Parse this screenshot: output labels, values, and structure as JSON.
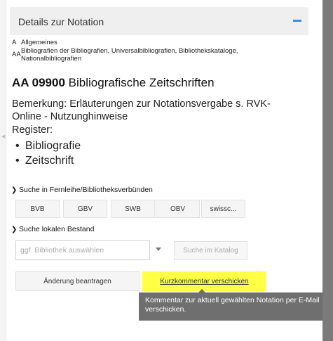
{
  "panel": {
    "title": "Details zur Notation"
  },
  "hierarchy": [
    {
      "code": "A",
      "label": "Allgemeines"
    },
    {
      "code": "AA",
      "label": "Bibliografien der Bibliografien, Universalbibliografien, Bibliothekskataloge, Nationalbibliografien"
    }
  ],
  "notation": {
    "code": "AA 09900",
    "title": "Bibliografische Zeitschriften"
  },
  "remark": "Bemerkung: Erläuterungen zur Notationsvergabe s. RVK-Online - Nutzunghinweise",
  "register": {
    "label": "Register:",
    "items": [
      "Bibliografie",
      "Zeitschrift"
    ]
  },
  "fernleihe": {
    "heading": "Suche in Fernleihe/Bibliotheksverbünden",
    "buttons": [
      "BVB",
      "GBV",
      "SWB",
      "OBV",
      "swissc..."
    ]
  },
  "local": {
    "heading": "Suche lokalen Bestand",
    "select_placeholder": "ggf. Bibliothek auswählen",
    "search_button": "Suche im Katalog"
  },
  "actions": {
    "change_button": "Änderung beantragen",
    "comment_button": "Kurzkommentar verschicken"
  },
  "tooltip": {
    "line1": "Kommentar zur aktuell gewählten Notation per E-Mail",
    "line2": "verschicken."
  },
  "colors": {
    "accent": "#3a8fd8",
    "highlight": "#ffff45",
    "tooltip_bg": "#6f6f6f"
  },
  "icons": {
    "collapse": "minus-icon",
    "section_caret": "chevron-right-icon",
    "select_caret": "caret-down-icon"
  }
}
